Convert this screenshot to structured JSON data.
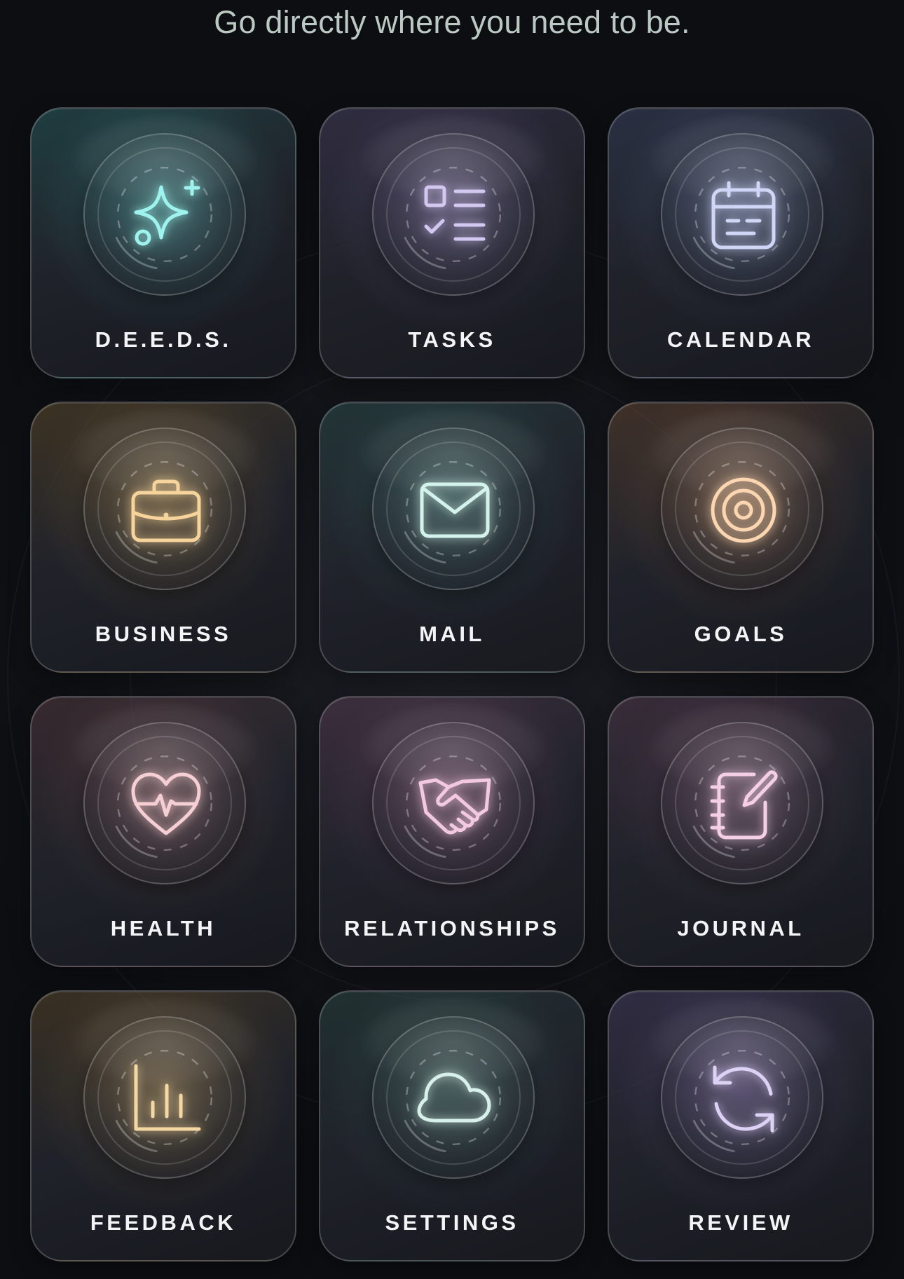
{
  "header": {
    "subtitle": "Go directly where you need to be."
  },
  "tiles": [
    {
      "key": "deeds",
      "label": "D.E.E.D.S.",
      "icon": "sparkle-icon",
      "accent": "#9ef3ee",
      "tint": "#3f8d8e"
    },
    {
      "key": "tasks",
      "label": "TASKS",
      "icon": "checklist-icon",
      "accent": "#d2c8f0",
      "tint": "#6c5f8e"
    },
    {
      "key": "calendar",
      "label": "CALENDAR",
      "icon": "calendar-icon",
      "accent": "#cfd6f6",
      "tint": "#5b6a92"
    },
    {
      "key": "business",
      "label": "BUSINESS",
      "icon": "briefcase-icon",
      "accent": "#f6d49b",
      "tint": "#8a6e3d"
    },
    {
      "key": "mail",
      "label": "MAIL",
      "icon": "mail-icon",
      "accent": "#d4f3ec",
      "tint": "#3c6b67"
    },
    {
      "key": "goals",
      "label": "GOALS",
      "icon": "target-icon",
      "accent": "#fbd6b0",
      "tint": "#8c6244"
    },
    {
      "key": "health",
      "label": "HEALTH",
      "icon": "heart-pulse-icon",
      "accent": "#f5cfd3",
      "tint": "#7b5459"
    },
    {
      "key": "relationships",
      "label": "RELATIONSHIPS",
      "icon": "handshake-icon",
      "accent": "#f3c9df",
      "tint": "#7b5170"
    },
    {
      "key": "journal",
      "label": "JOURNAL",
      "icon": "notebook-pen-icon",
      "accent": "#f4cfe5",
      "tint": "#735068"
    },
    {
      "key": "feedback",
      "label": "FEEDBACK",
      "icon": "bar-chart-icon",
      "accent": "#f4d8a3",
      "tint": "#846a3e"
    },
    {
      "key": "settings",
      "label": "SETTINGS",
      "icon": "cloud-icon",
      "accent": "#d7f1ea",
      "tint": "#3e6560"
    },
    {
      "key": "review",
      "label": "REVIEW",
      "icon": "refresh-icon",
      "accent": "#ddd2f5",
      "tint": "#6a5b8e"
    }
  ]
}
